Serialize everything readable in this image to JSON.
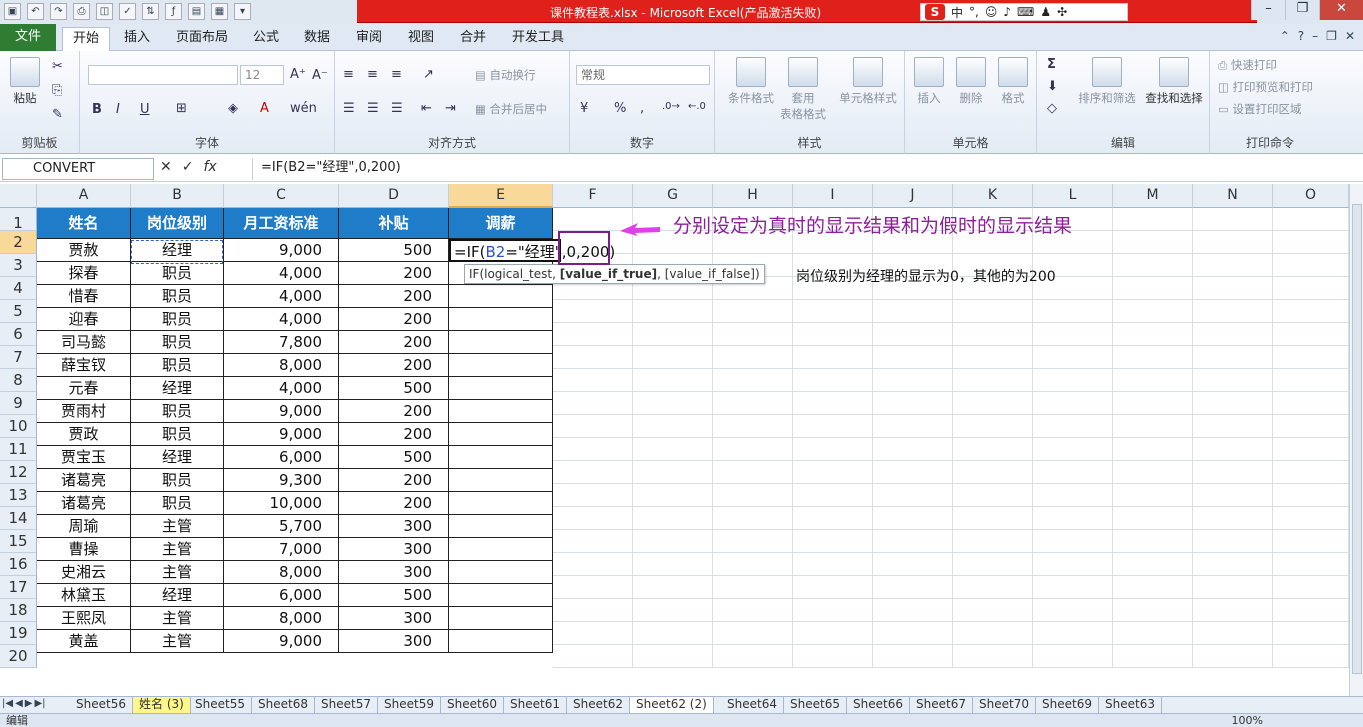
{
  "window": {
    "title": "课件教程表.xlsx - Microsoft Excel(产品激活失败)",
    "ime_label": "中"
  },
  "ribbon_tabs": [
    {
      "label": "文件"
    },
    {
      "label": "开始"
    },
    {
      "label": "插入"
    },
    {
      "label": "页面布局"
    },
    {
      "label": "公式"
    },
    {
      "label": "数据"
    },
    {
      "label": "审阅"
    },
    {
      "label": "视图"
    },
    {
      "label": "合并"
    },
    {
      "label": "开发工具"
    }
  ],
  "ribbon": {
    "clipboard": {
      "label": "剪贴板",
      "paste": "粘贴"
    },
    "font": {
      "label": "字体",
      "size": "12",
      "bold": "B",
      "italic": "I",
      "underline": "U"
    },
    "alignment": {
      "label": "对齐方式",
      "wrap": "自动换行",
      "merge": "合并后居中"
    },
    "number": {
      "label": "数字",
      "format": "常规",
      "percent": "%",
      "comma": ","
    },
    "styles": {
      "label": "样式",
      "conditional": "条件格式",
      "table1": "套用",
      "table2": "表格格式",
      "cell_styles": "单元格样式"
    },
    "cells": {
      "label": "单元格",
      "insert": "插入",
      "delete": "删除",
      "format": "格式"
    },
    "editing": {
      "label": "编辑",
      "sigma": "Σ",
      "sort": "排序和筛选",
      "find": "查找和选择"
    },
    "print": {
      "label": "打印命令",
      "quick": "快速打印",
      "preview": "打印预览和打印",
      "area": "设置打印区域"
    }
  },
  "formula_bar": {
    "name_box": "CONVERT",
    "cancel": "✕",
    "enter": "✓",
    "fx": "fx",
    "formula": "=IF(B2=\"经理\",0,200)"
  },
  "columns": [
    "A",
    "B",
    "C",
    "D",
    "E",
    "F",
    "G",
    "H",
    "I",
    "J",
    "K",
    "L",
    "M",
    "N",
    "O"
  ],
  "rows": [
    "1",
    "2",
    "3",
    "4",
    "5",
    "6",
    "7",
    "8",
    "9",
    "10",
    "11",
    "12",
    "13",
    "14",
    "15",
    "16",
    "17",
    "18",
    "19",
    "20"
  ],
  "table": {
    "headers": [
      "姓名",
      "岗位级别",
      "月工资标准",
      "补贴",
      "调薪"
    ],
    "data": [
      [
        "贾赦",
        "经理",
        "9,000",
        "500"
      ],
      [
        "探春",
        "职员",
        "4,000",
        "200"
      ],
      [
        "惜春",
        "职员",
        "4,000",
        "200"
      ],
      [
        "迎春",
        "职员",
        "4,000",
        "200"
      ],
      [
        "司马懿",
        "职员",
        "7,800",
        "200"
      ],
      [
        "薛宝钗",
        "职员",
        "8,000",
        "200"
      ],
      [
        "元春",
        "经理",
        "4,000",
        "500"
      ],
      [
        "贾雨村",
        "职员",
        "9,000",
        "200"
      ],
      [
        "贾政",
        "职员",
        "9,000",
        "200"
      ],
      [
        "贾宝玉",
        "经理",
        "6,000",
        "500"
      ],
      [
        "诸葛亮",
        "职员",
        "9,300",
        "200"
      ],
      [
        "诸葛亮",
        "职员",
        "10,000",
        "200"
      ],
      [
        "周瑜",
        "主管",
        "5,700",
        "300"
      ],
      [
        "曹操",
        "主管",
        "7,000",
        "300"
      ],
      [
        "史湘云",
        "主管",
        "8,000",
        "300"
      ],
      [
        "林黛玉",
        "经理",
        "6,000",
        "500"
      ],
      [
        "王熙凤",
        "主管",
        "8,000",
        "300"
      ],
      [
        "黄盖",
        "主管",
        "9,000",
        "300"
      ]
    ],
    "editing_cell": {
      "prefix": "=IF(",
      "ref": "B2",
      "rest": "=\"经理\"",
      "tail": ",0,200)"
    }
  },
  "tooltip": {
    "text1": "IF(logical_test, ",
    "bold": "[value_if_true]",
    "text2": ", [value_if_false])"
  },
  "note": "岗位级别为经理的显示为0，其他的为200",
  "annotation": "分别设定为真时的显示结果和为假时的显示结果",
  "sheets": [
    "Sheet56",
    "姓名 (3)",
    "Sheet55",
    "Sheet68",
    "Sheet57",
    "Sheet59",
    "Sheet60",
    "Sheet61",
    "Sheet62",
    "Sheet62 (2)",
    "Sheet64",
    "Sheet65",
    "Sheet66",
    "Sheet67",
    "Sheet70",
    "Sheet69",
    "Sheet63"
  ],
  "status": {
    "mode": "编辑",
    "zoom": "100%"
  },
  "colors": {
    "accent": "#1f7cc9",
    "file_tab": "#2e7d32",
    "annotation": "#8e1f9a",
    "title_bar": "#e0201b"
  }
}
